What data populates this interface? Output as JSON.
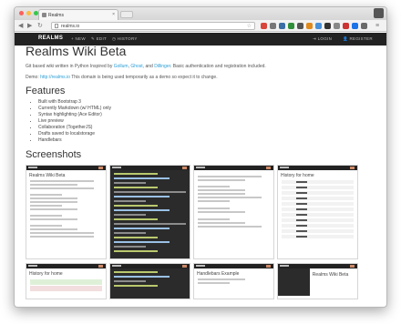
{
  "browser": {
    "tab_title": "Realms",
    "tab_close": "×",
    "url": "realms.io",
    "back": "◀",
    "forward": "▶",
    "reload": "↻"
  },
  "navbar": {
    "brand": "REALMS",
    "items": [
      "NEW",
      "EDIT",
      "HISTORY"
    ],
    "right_items": [
      "LOGIN",
      "REGISTER"
    ]
  },
  "page": {
    "title": "Realms Wiki Beta",
    "description_prefix": "Git based wiki written in Python Inspired by ",
    "links": [
      "Gollum",
      "Ghost",
      "Dillinger"
    ],
    "description_suffix": ". Basic authentication and registration included.",
    "demo_prefix": "Demo: ",
    "demo_link": "http://realms.io",
    "demo_suffix": " This domain is being used temporarily as a demo so expect it to change.",
    "features_heading": "Features",
    "features": [
      "Built with Bootstrap 3",
      "Currently Markdown (w/ HTML) only",
      "Syntax highlighting (Ace Editor)",
      "Live preview",
      "Collaboration (TogetherJS)",
      "Drafts saved to localstorage",
      "Handlebars"
    ],
    "screenshots_heading": "Screenshots"
  },
  "thumbnails": {
    "home_title": "Realms Wiki Beta",
    "history_title": "History for home",
    "handlebars_title": "Handlebars Example"
  },
  "colors": {
    "navbar": "#222222",
    "link": "#2a9fd6",
    "heading": "#333333"
  }
}
